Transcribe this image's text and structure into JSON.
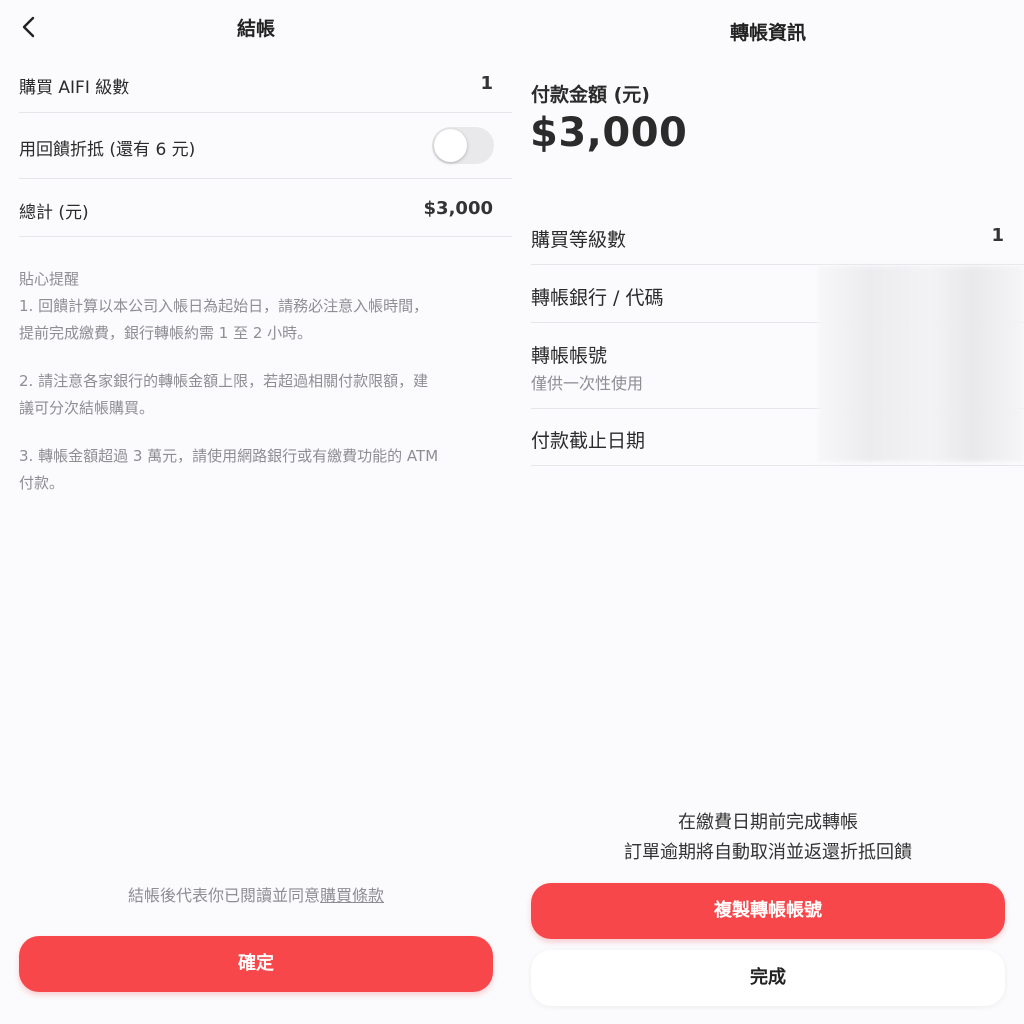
{
  "checkout": {
    "title": "結帳",
    "rows": {
      "aifi_level": {
        "label": "購買 AIFI 級數",
        "value": "1"
      },
      "rebate": {
        "label": "用回饋折抵 (還有 6 元)",
        "toggle_on": false
      },
      "total": {
        "label": "總計 (元)",
        "value": "$3,000"
      }
    },
    "notes": {
      "heading": "貼心提醒",
      "items": [
        [
          "1. 回饋計算以本公司入帳日為起始日，請務必注意入帳時間，",
          "提前完成繳費，銀行轉帳約需 1 至 2 小時。"
        ],
        [
          "2. 請注意各家銀行的轉帳金額上限，若超過相關付款限額，建",
          "議可分次結帳購買。"
        ],
        [
          "3. 轉帳金額超過 3 萬元，請使用網路銀行或有繳費功能的 ATM",
          "付款。"
        ]
      ]
    },
    "terms_prefix": "結帳後代表你已閱讀並同意",
    "terms_link": "購買條款",
    "confirm_label": "確定"
  },
  "transfer": {
    "title": "轉帳資訊",
    "amount_label": "付款金額 (元)",
    "amount_value": "$3,000",
    "rows": {
      "level": {
        "label": "購買等級數",
        "value": "1"
      },
      "bank": {
        "label": "轉帳銀行 / 代碼"
      },
      "account": {
        "label": "轉帳帳號",
        "sublabel": "僅供一次性使用"
      },
      "deadline": {
        "label": "付款截止日期"
      }
    },
    "warning_line1": "在繳費日期前完成轉帳",
    "warning_line2": "訂單逾期將自動取消並返還折抵回饋",
    "copy_label": "複製轉帳帳號",
    "done_label": "完成"
  },
  "colors": {
    "accent": "#f8474a",
    "background": "#fbfbfd",
    "muted_text": "#8e8e93",
    "divider": "#e6e6ea"
  },
  "icons": {
    "back": "chevron-left-icon"
  }
}
